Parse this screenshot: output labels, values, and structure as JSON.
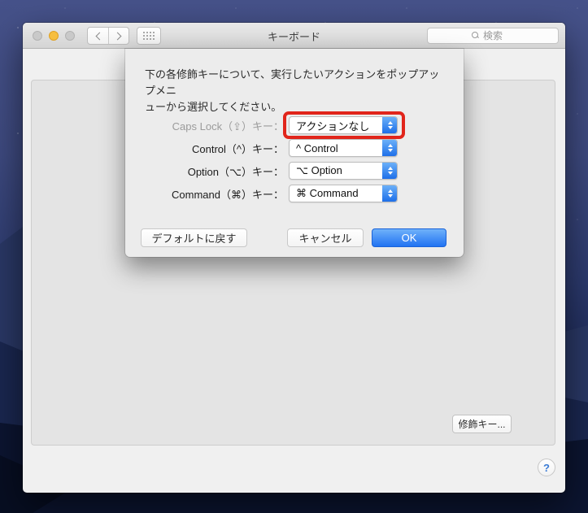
{
  "desktop": {
    "sky_color": "#46528a",
    "mountain_color": "#1a2750",
    "ground_color": "#0c1531"
  },
  "window": {
    "title": "キーボード",
    "toolbar": {
      "search_placeholder": "検索"
    }
  },
  "sheet": {
    "instruction_lines": [
      "下の各修飾キーについて、実行したいアクションをポップアップメニ",
      "ューから選択してください。"
    ],
    "rows": [
      {
        "label": "Caps Lock（⇪）キー：",
        "value": "アクションなし",
        "disabled": true,
        "highlighted": true
      },
      {
        "label": "Control（^）キー：",
        "value": "^ Control"
      },
      {
        "label": "Option（⌥）キー：",
        "value": "⌥ Option"
      },
      {
        "label": "Command（⌘）キー：",
        "value": "⌘ Command"
      }
    ],
    "footer": {
      "defaults_label": "デフォルトに戻す",
      "cancel_label": "キャンセル",
      "ok_label": "OK"
    }
  },
  "pane": {
    "modifier_keys_label": "修飾キー...",
    "help_label": "?"
  },
  "colors": {
    "accent_blue": "#2173f2",
    "stepper_blue_top": "#6fb3f9",
    "stepper_blue_bottom": "#1a6ce8",
    "annotation_red": "#e1251b",
    "minimize_yellow": "#f6be40"
  },
  "icons": [
    "close-icon",
    "minimize-icon",
    "zoom-icon",
    "back-chevron-icon",
    "forward-chevron-icon",
    "grid-icon",
    "search-icon",
    "stepper-icon",
    "help-icon"
  ]
}
